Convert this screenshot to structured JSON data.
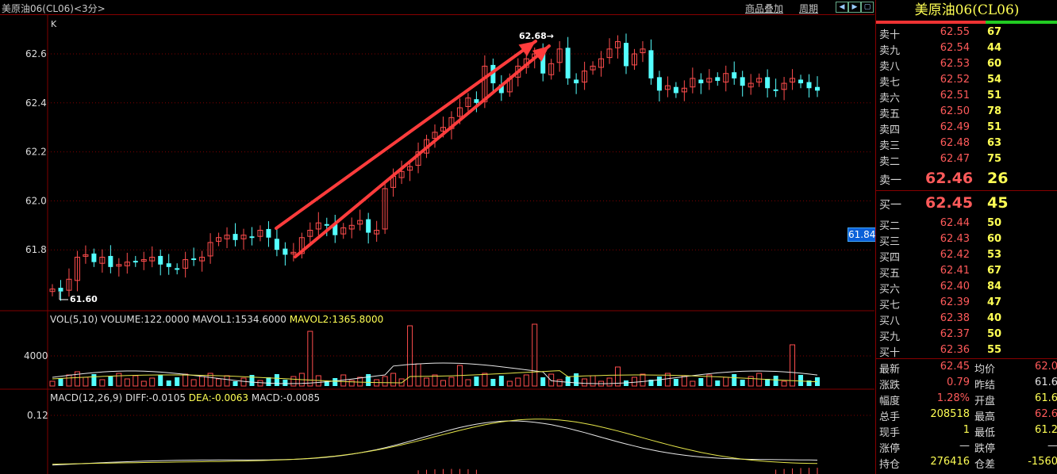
{
  "header": {
    "title": "美原油06(CL06)<3分>",
    "overlay_link": "商品叠加",
    "period_link": "周期"
  },
  "kline": {
    "label": "K",
    "y_ticks": [
      "62.6",
      "62.4",
      "62.2",
      "62.0",
      "61.8"
    ],
    "high_annotation": "62.68",
    "low_annotation": "61.60",
    "current_price_tag": "61.84"
  },
  "volume": {
    "legend_prefix": "VOL(5,10) VOLUME:122.0000 MAVOL1:1534.6000",
    "legend_mavol2": "MAVOL2:1365.8000",
    "y_tick": "4000"
  },
  "macd": {
    "legend_prefix": "MACD(12,26,9) DIFF:-0.0105",
    "legend_dea": "DEA:-0.0063",
    "legend_macd": "MACD:-0.0085",
    "y_tick": "0.12"
  },
  "panel": {
    "title": "美原油06(CL06)",
    "asks": [
      {
        "label": "卖十",
        "price": "62.55",
        "vol": "67"
      },
      {
        "label": "卖九",
        "price": "62.54",
        "vol": "44"
      },
      {
        "label": "卖八",
        "price": "62.53",
        "vol": "60"
      },
      {
        "label": "卖七",
        "price": "62.52",
        "vol": "54"
      },
      {
        "label": "卖六",
        "price": "62.51",
        "vol": "51"
      },
      {
        "label": "卖五",
        "price": "62.50",
        "vol": "78"
      },
      {
        "label": "卖四",
        "price": "62.49",
        "vol": "51"
      },
      {
        "label": "卖三",
        "price": "62.48",
        "vol": "63"
      },
      {
        "label": "卖二",
        "price": "62.47",
        "vol": "75"
      },
      {
        "label": "卖一",
        "price": "62.46",
        "vol": "26"
      }
    ],
    "bids": [
      {
        "label": "买一",
        "price": "62.45",
        "vol": "45"
      },
      {
        "label": "买二",
        "price": "62.44",
        "vol": "50"
      },
      {
        "label": "买三",
        "price": "62.43",
        "vol": "60"
      },
      {
        "label": "买四",
        "price": "62.42",
        "vol": "53"
      },
      {
        "label": "买五",
        "price": "62.41",
        "vol": "67"
      },
      {
        "label": "买六",
        "price": "62.40",
        "vol": "84"
      },
      {
        "label": "买七",
        "price": "62.39",
        "vol": "47"
      },
      {
        "label": "买八",
        "price": "62.38",
        "vol": "40"
      },
      {
        "label": "买九",
        "price": "62.37",
        "vol": "50"
      },
      {
        "label": "买十",
        "price": "62.36",
        "vol": "55"
      }
    ],
    "stats": [
      {
        "l1": "最新",
        "v1": "62.45",
        "c1": "c-red",
        "l2": "均价",
        "v2": "62.0",
        "c2": "c-red"
      },
      {
        "l1": "涨跌",
        "v1": "0.79",
        "c1": "c-red",
        "l2": "昨结",
        "v2": "61.6",
        "c2": "c-white"
      },
      {
        "l1": "幅度",
        "v1": "1.28%",
        "c1": "c-red",
        "l2": "开盘",
        "v2": "61.6",
        "c2": "c-yel"
      },
      {
        "l1": "总手",
        "v1": "208518",
        "c1": "c-yel",
        "l2": "最高",
        "v2": "62.6",
        "c2": "c-red"
      },
      {
        "l1": "现手",
        "v1": "1",
        "c1": "c-yel",
        "l2": "最低",
        "v2": "61.2",
        "c2": "c-yel"
      },
      {
        "l1": "涨停",
        "v1": "—",
        "c1": "c-white",
        "l2": "跌停",
        "v2": "—",
        "c2": "c-white"
      },
      {
        "l1": "持仓",
        "v1": "276416",
        "c1": "c-yel",
        "l2": "仓差",
        "v2": "-1560",
        "c2": "c-yel"
      }
    ]
  },
  "colors": {
    "up": "#ff4d4d",
    "down": "#54ffff",
    "arrow": "#ff3c3c",
    "grid": "#800000",
    "ma_white": "#e8e8e8",
    "ma_yellow": "#e6e64a"
  },
  "chart_data": {
    "type": "candlestick",
    "title": "美原油06(CL06)<3分>",
    "y_range": [
      61.6,
      62.7
    ],
    "high": 62.68,
    "low": 61.6,
    "closes": [
      61.64,
      61.63,
      61.68,
      61.77,
      61.78,
      61.75,
      61.77,
      61.73,
      61.74,
      61.75,
      61.75,
      61.76,
      61.77,
      61.74,
      61.73,
      61.72,
      61.76,
      61.76,
      61.77,
      61.83,
      61.85,
      61.86,
      61.84,
      61.86,
      61.85,
      61.88,
      61.85,
      61.8,
      61.78,
      61.79,
      61.85,
      61.88,
      61.91,
      61.9,
      61.86,
      61.89,
      61.9,
      61.92,
      61.87,
      61.88,
      62.05,
      62.1,
      62.12,
      62.14,
      62.2,
      62.25,
      62.28,
      62.3,
      62.34,
      62.38,
      62.42,
      62.4,
      62.55,
      62.48,
      62.44,
      62.5,
      62.55,
      62.58,
      62.6,
      62.52,
      62.56,
      62.62,
      62.5,
      62.48,
      62.53,
      62.55,
      62.58,
      62.62,
      62.65,
      62.55,
      62.6,
      62.62,
      62.5,
      62.45,
      62.47,
      62.44,
      62.46,
      62.5,
      62.48,
      62.5,
      62.49,
      62.52,
      62.5,
      62.47,
      62.48,
      62.5,
      62.46,
      62.45,
      62.48,
      62.5,
      62.48,
      62.46,
      62.45
    ]
  }
}
